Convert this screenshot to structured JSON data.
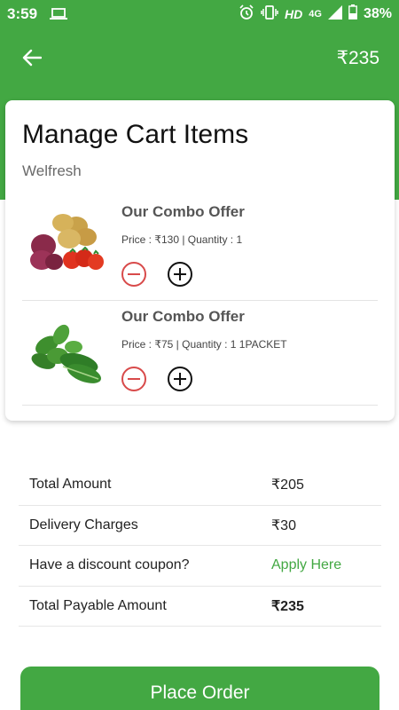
{
  "status_bar": {
    "time": "3:59",
    "hd": "HD",
    "network": "4G",
    "battery": "38%"
  },
  "header": {
    "total": "₹235"
  },
  "cart": {
    "title": "Manage Cart Items",
    "store": "Welfresh",
    "items": [
      {
        "name": "Our Combo Offer",
        "meta": "Price : ₹130 | Quantity : 1",
        "image": "vegetables-combo"
      },
      {
        "name": "Our Combo Offer",
        "meta": "Price : ₹75 | Quantity : 1 1PACKET",
        "image": "leafy-greens"
      }
    ]
  },
  "summary": {
    "rows": [
      {
        "label": "Total Amount",
        "value": "₹205"
      },
      {
        "label": "Delivery Charges",
        "value": "₹30"
      },
      {
        "label": "Have a discount coupon?",
        "value": "Apply Here"
      },
      {
        "label": "Total Payable Amount",
        "value": "₹235"
      }
    ]
  },
  "actions": {
    "place_order": "Place Order"
  },
  "colors": {
    "brand_green": "#43a843",
    "minus_red": "#d84a4a"
  }
}
